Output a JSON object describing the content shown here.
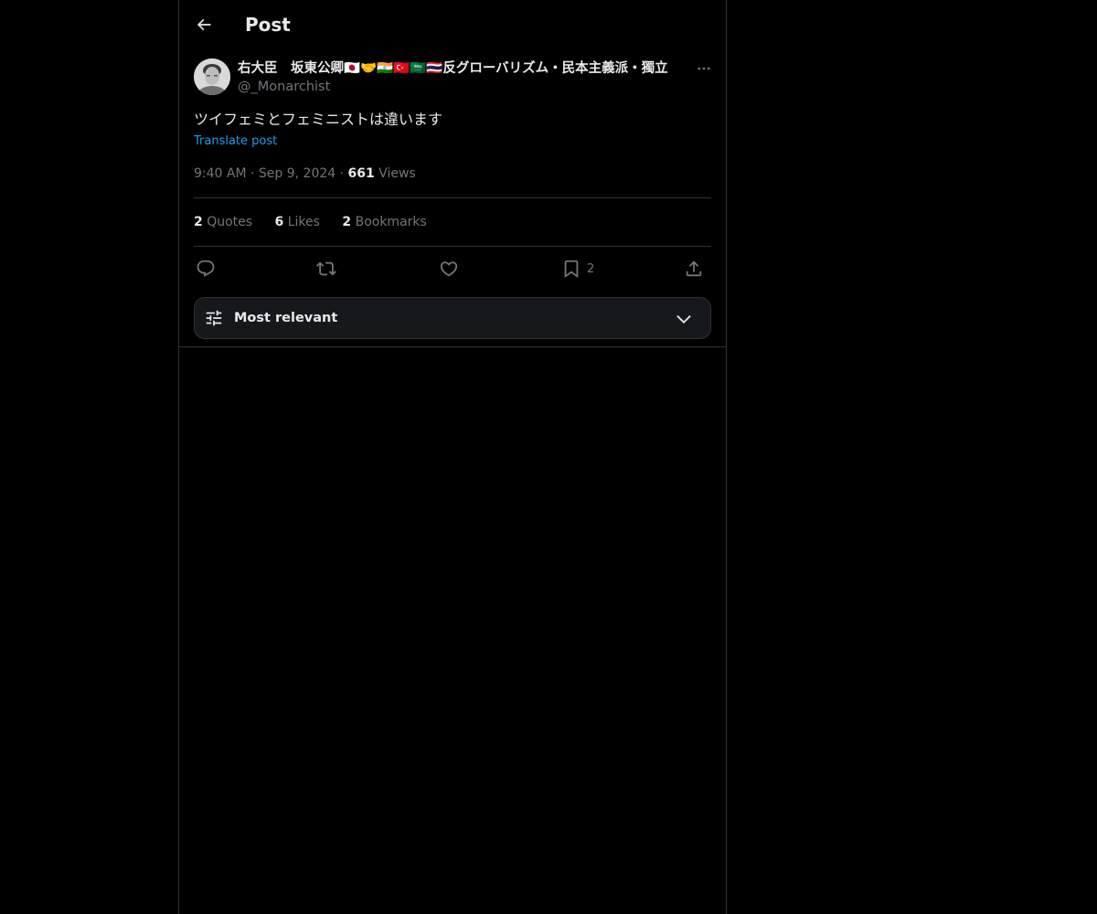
{
  "header": {
    "title": "Post",
    "back_icon": "arrow-left-icon"
  },
  "post": {
    "author": {
      "display_name": "右大臣　坂東公卿🇯🇵🤝🇮🇳🇹🇷🇸🇦🇹🇭反グローバリズム・民本主義派・獨立",
      "handle": "@_Monarchist"
    },
    "text": "ツイフェミとフェミニストは違います",
    "translate_label": "Translate post",
    "time": "9:40 AM",
    "date": "Sep 9, 2024",
    "views_count": "661",
    "views_label": "Views",
    "separator": "·",
    "stats": {
      "quotes_count": "2",
      "quotes_label": "Quotes",
      "likes_count": "6",
      "likes_label": "Likes",
      "bookmarks_count": "2",
      "bookmarks_label": "Bookmarks"
    },
    "actions": {
      "reply_icon": "reply-icon",
      "repost_icon": "repost-icon",
      "like_icon": "heart-icon",
      "bookmark_icon": "bookmark-icon",
      "bookmark_count": "2",
      "share_icon": "share-icon"
    }
  },
  "sort": {
    "label": "Most relevant",
    "icon": "sliders-icon",
    "chevron": "chevron-down-icon"
  },
  "colors": {
    "background": "#000000",
    "text_primary": "#e7e9ea",
    "text_secondary": "#71767b",
    "link": "#1d9bf0",
    "border": "#2f3336"
  }
}
